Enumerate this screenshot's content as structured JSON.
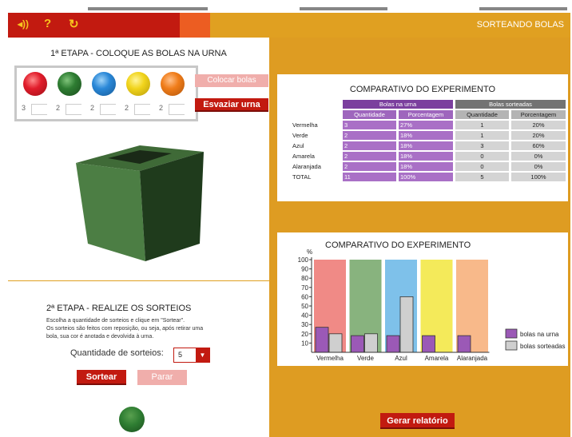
{
  "header": {
    "title": "SORTEANDO BOLAS",
    "icons": [
      "sound-icon",
      "help-icon",
      "restart-icon"
    ],
    "colors": {
      "red": "#c21a10",
      "orange": "#ec5d22",
      "gold": "#e0a021"
    }
  },
  "stage1": {
    "title": "1ª ETAPA - COLOQUE AS BOLAS NA URNA",
    "balls": [
      {
        "color": "#e11d2b",
        "name": "Vermelha",
        "qty": "3"
      },
      {
        "color": "#2e7d32",
        "name": "Verde",
        "qty": "2"
      },
      {
        "color": "#2a88d8",
        "name": "Azul",
        "qty": "2"
      },
      {
        "color": "#f1d41c",
        "name": "Amarela",
        "qty": "2"
      },
      {
        "color": "#f07d1a",
        "name": "Alaranjada",
        "qty": "2"
      }
    ],
    "place_button": "Colocar bolas",
    "empty_button": "Esvaziar urna"
  },
  "stage2": {
    "title": "2ª ETAPA - REALIZE OS SORTEIOS",
    "instructions": [
      "Escolha a quantidade de sorteios e clique em \"Sortear\".",
      "Os sorteios são feitos com reposição, ou seja, após retirar uma",
      "bola, sua cor é anotada e devolvida à urna."
    ],
    "quantity_label": "Quantidade de sorteios:",
    "quantity_value": "5",
    "draw_button": "Sortear",
    "stop_button": "Parar"
  },
  "table": {
    "title": "COMPARATIVO DO EXPERIMENTO",
    "group_urn": "Bolas na urna",
    "group_drawn": "Bolas sorteadas",
    "col_qty": "Quantidade",
    "col_pct": "Porcentagem",
    "rows": [
      {
        "label": "Vermelha",
        "urn_qty": "3",
        "urn_pct": "27%",
        "drawn_qty": "1",
        "drawn_pct": "20%"
      },
      {
        "label": "Verde",
        "urn_qty": "2",
        "urn_pct": "18%",
        "drawn_qty": "1",
        "drawn_pct": "20%"
      },
      {
        "label": "Azul",
        "urn_qty": "2",
        "urn_pct": "18%",
        "drawn_qty": "3",
        "drawn_pct": "60%"
      },
      {
        "label": "Amarela",
        "urn_qty": "2",
        "urn_pct": "18%",
        "drawn_qty": "0",
        "drawn_pct": "0%"
      },
      {
        "label": "Alaranjada",
        "urn_qty": "2",
        "urn_pct": "18%",
        "drawn_qty": "0",
        "drawn_pct": "0%"
      },
      {
        "label": "TOTAL",
        "urn_qty": "11",
        "urn_pct": "100%",
        "drawn_qty": "5",
        "drawn_pct": "100%"
      }
    ]
  },
  "chart_data": {
    "type": "bar",
    "title": "COMPARATIVO DO EXPERIMENTO",
    "ylabel": "%",
    "ylim": [
      0,
      100
    ],
    "yticks": [
      10,
      20,
      30,
      40,
      50,
      60,
      70,
      80,
      90,
      100
    ],
    "categories": [
      "Vermelha",
      "Verde",
      "Azul",
      "Amarela",
      "Alaranjada"
    ],
    "category_colors": [
      "#f08a86",
      "#88b37e",
      "#7ec1ea",
      "#f4ea5a",
      "#f8b98a"
    ],
    "series": [
      {
        "name": "bolas na urna",
        "color": "#9b59b6",
        "values": [
          27,
          18,
          18,
          18,
          18
        ]
      },
      {
        "name": "bolas sorteadas",
        "color": "#cfcfcf",
        "values": [
          20,
          20,
          60,
          0,
          0
        ]
      }
    ],
    "legend": "right",
    "grid": false
  },
  "report_button": "Gerar relatório"
}
